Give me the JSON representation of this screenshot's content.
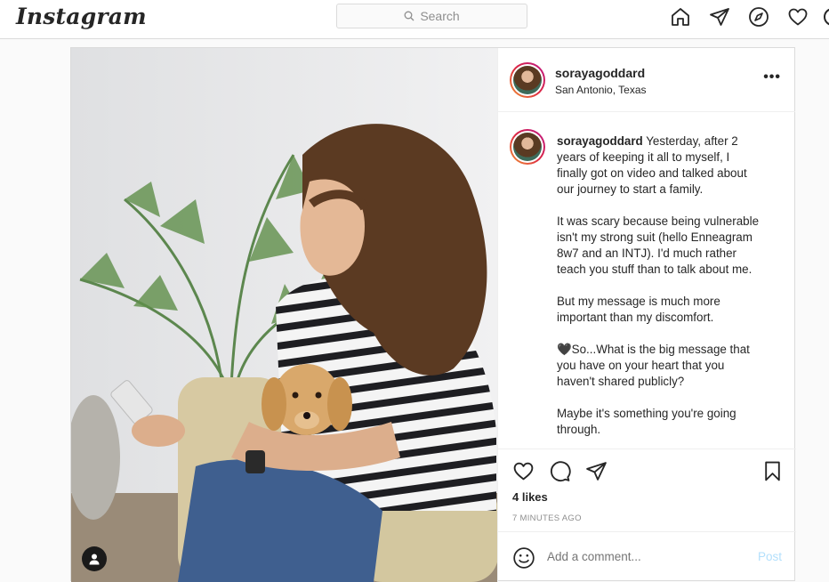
{
  "brand": {
    "logo": "Instagram"
  },
  "search": {
    "placeholder": "Search"
  },
  "nav": {
    "icons": [
      "home-icon",
      "direct-icon",
      "explore-icon",
      "activity-icon"
    ]
  },
  "post": {
    "username": "sorayagoddard",
    "location": "San Antonio, Texas",
    "caption": {
      "username": "sorayagoddard",
      "lines": [
        "Yesterday, after 2",
        "years of keeping it all to myself, I",
        "finally got on video and talked about",
        "our journey to start a family."
      ],
      "p2": [
        "It was scary because being vulnerable",
        "isn't my strong suit (hello Enneagram",
        "8w7 and an INTJ). I'd much rather",
        "teach you stuff than to talk about me."
      ],
      "p3": [
        "But my message is much more",
        "important than my discomfort."
      ],
      "p4": [
        "🖤So...What is the big message that",
        "you have on your heart that you",
        "haven't shared publicly?"
      ],
      "p5": [
        "Maybe it's something you're going",
        "through."
      ]
    },
    "likes": "4 likes",
    "timestamp": "7 MINUTES AGO",
    "comment_placeholder": "Add a comment...",
    "post_label": "Post"
  },
  "colors": {
    "accent_disabled": "#b2dffc",
    "border": "#dbdbdb",
    "muted": "#8e8e8e"
  }
}
